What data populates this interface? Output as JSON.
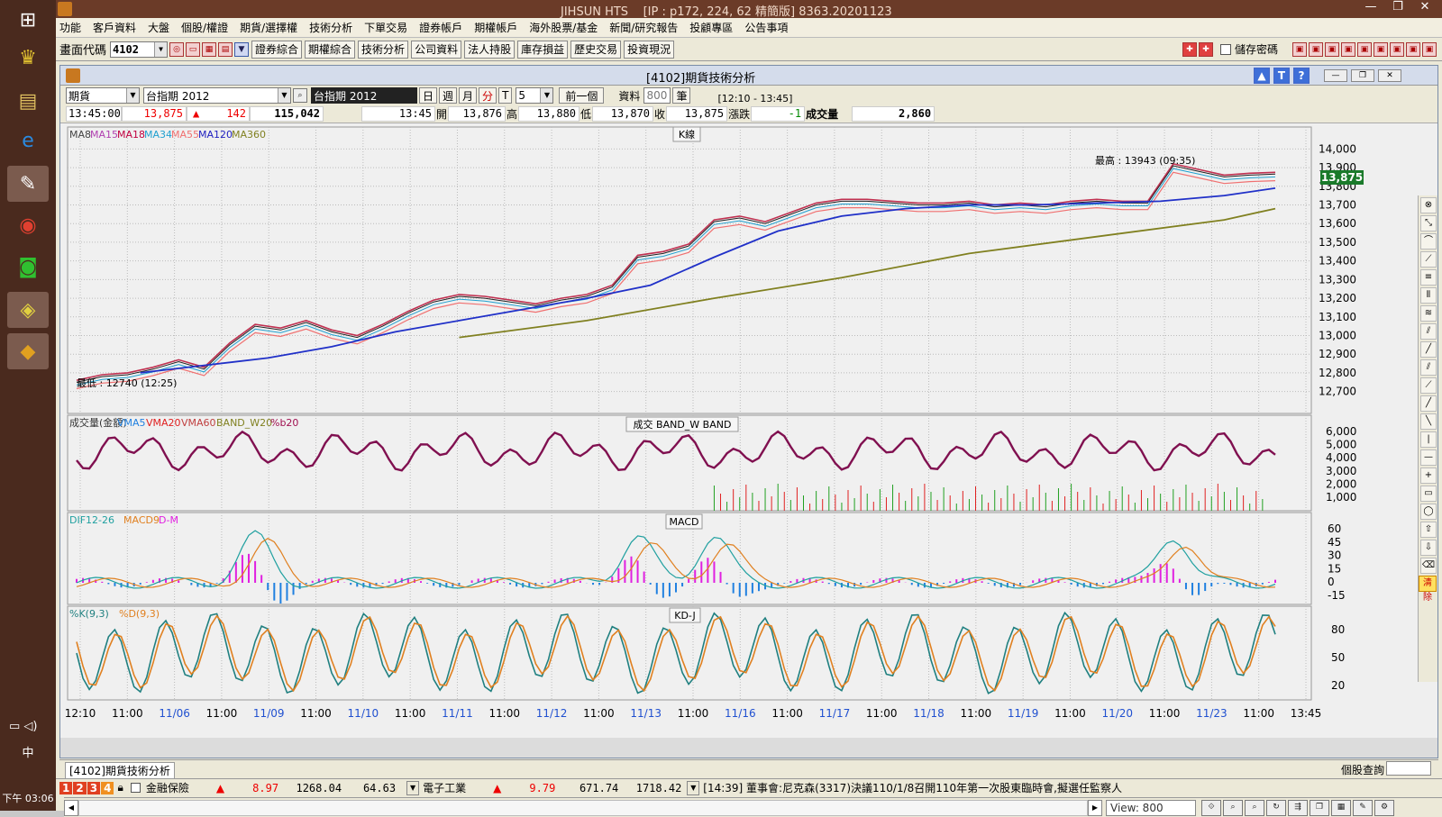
{
  "taskbar": {
    "clock": "下午 03:06",
    "ime": "中"
  },
  "window": {
    "title": "JIHSUN HTS",
    "server": "[IP : p172, 224, 62 精簡版] 8363.20201123"
  },
  "menu": [
    "功能",
    "客戶資料",
    "大盤",
    "個股/權證",
    "期貨/選擇權",
    "技術分析",
    "下單交易",
    "證券帳戶",
    "期權帳戶",
    "海外股票/基金",
    "新聞/研究報告",
    "投顧專區",
    "公告事項"
  ],
  "toolbar": {
    "code_label": "畫面代碼",
    "code_value": "4102",
    "buttons": [
      "證券綜合",
      "期權綜合",
      "技術分析",
      "公司資料",
      "法人持股",
      "庫存損益",
      "歷史交易",
      "投資現況"
    ],
    "save_pwd": "儲存密碼"
  },
  "inner": {
    "title": "[4102]期貨技術分析"
  },
  "ctrl": {
    "type": "期貨",
    "contract": "台指期 2012",
    "contract_name": "台指期 2012",
    "day": "日",
    "week": "週",
    "month": "月",
    "minute": "分",
    "tick": "T",
    "period": "5",
    "prev": "前一個",
    "data_label": "資料",
    "data_count": "800",
    "unit": "筆",
    "range": "[12:10 - 13:45]"
  },
  "quote": {
    "time": "13:45:00",
    "price": "13,875",
    "change": "142",
    "vol": "115,042",
    "t2": "13:45",
    "open_l": "開",
    "open": "13,876",
    "high_l": "高",
    "high": "13,880",
    "low_l": "低",
    "low": "13,870",
    "close_l": "收",
    "close": "13,875",
    "chg_l": "漲跌",
    "chg": "-1",
    "vol_l": "成交量",
    "vol2": "2,860"
  },
  "chart_data": [
    {
      "type": "line",
      "title": "K線",
      "legend": [
        "MA8",
        "MA15",
        "MA18",
        "MA34",
        "MA55",
        "MA120",
        "MA360"
      ],
      "legend_colors": [
        "#444444",
        "#b040b0",
        "#c00040",
        "#20a0d0",
        "#f07070",
        "#2020c0",
        "#808020"
      ],
      "high_label": "最高 : 13943 (09:35)",
      "low_label": "最低 : 12740 (12:25)",
      "last": "13,875",
      "yticks": [
        "14,000",
        "13,900",
        "13,800",
        "13,700",
        "13,600",
        "13,500",
        "13,400",
        "13,300",
        "13,200",
        "13,100",
        "13,000",
        "12,900",
        "12,800",
        "12,700"
      ],
      "ylim": [
        12650,
        14050
      ],
      "series": [
        {
          "name": "MA120",
          "points": [
            [
              0,
              12820
            ],
            [
              10,
              12950
            ],
            [
              20,
              13040
            ],
            [
              30,
              13120
            ],
            [
              40,
              13190
            ],
            [
              50,
              13300
            ],
            [
              60,
              13560
            ],
            [
              70,
              13660
            ],
            [
              80,
              13700
            ],
            [
              90,
              13760
            ]
          ]
        },
        {
          "name": "MA360",
          "points": [
            [
              30,
              13000
            ],
            [
              40,
              13080
            ],
            [
              50,
              13200
            ],
            [
              60,
              13330
            ],
            [
              70,
              13450
            ],
            [
              80,
              13530
            ],
            [
              90,
              13670
            ]
          ]
        }
      ]
    },
    {
      "type": "bar",
      "title": "成交  BAND_W  BAND",
      "legend": [
        "成交量(金額)",
        "VMA5",
        "VMA20",
        "VMA60",
        "BAND_W20",
        "%b20"
      ],
      "legend_colors": [
        "#333333",
        "#2080e0",
        "#e02020",
        "#c04040",
        "#808020",
        "#a01050"
      ],
      "yticks": [
        "6,000",
        "5,000",
        "4,000",
        "3,000",
        "2,000",
        "1,000"
      ]
    },
    {
      "type": "line",
      "title": "MACD",
      "legend": [
        "DIF12-26",
        "MACD9",
        "D-M"
      ],
      "legend_colors": [
        "#20a0a0",
        "#e08020",
        "#e020e0"
      ],
      "yticks": [
        "60",
        "45",
        "30",
        "15",
        "0",
        "-15"
      ]
    },
    {
      "type": "line",
      "title": "KD-J",
      "legend": [
        "%K(9,3)",
        "%D(9,3)"
      ],
      "legend_colors": [
        "#208080",
        "#e08020"
      ],
      "yticks": [
        "80",
        "50",
        "20"
      ]
    }
  ],
  "xaxis": [
    "12:10",
    "11:00",
    "11/06",
    "11:00",
    "11/09",
    "11:00",
    "11/10",
    "11:00",
    "11/11",
    "11:00",
    "11/12",
    "11:00",
    "11/13",
    "11:00",
    "11/16",
    "11:00",
    "11/17",
    "11:00",
    "11/18",
    "11:00",
    "11/19",
    "11:00",
    "11/20",
    "11:00",
    "11/23",
    "11:00",
    "13:45"
  ],
  "bottom": {
    "view": "View:  800",
    "clear": "清除"
  },
  "status1": {
    "tab": "[4102]期貨技術分析",
    "right": "個股查詢"
  },
  "status2": {
    "f1": "金融保險",
    "f1v": "8.97",
    "f1a": "1268.04",
    "f1b": "64.63",
    "f2": "電子工業",
    "f2v": "9.79",
    "f2a": "671.74",
    "f2b": "1718.42",
    "news": "[14:39]  董事會:尼克森(3317)決議110/1/8召開110年第一次股東臨時會,擬選任監察人"
  }
}
